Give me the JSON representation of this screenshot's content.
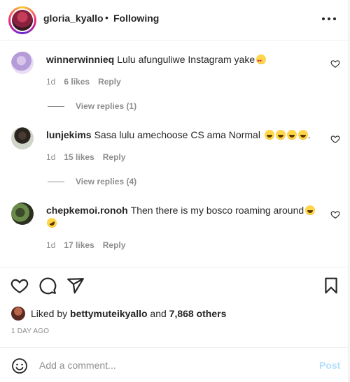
{
  "header": {
    "username": "gloria_kyallo",
    "separator": "•",
    "follow_status": "Following"
  },
  "comments": [
    {
      "username": "winnerwinnieq",
      "text": "Lulu afunguliwe Instagram yake",
      "emojis": [
        "heart-eyes"
      ],
      "time": "1d",
      "likes": "6 likes",
      "reply_label": "Reply",
      "view_replies": "View replies (1)"
    },
    {
      "username": "lunjekims",
      "text": "Sasa lulu amechoose CS ama Normal",
      "emojis": [
        "laughing",
        "laughing",
        "laughing",
        "laughing"
      ],
      "trailing": ".",
      "time": "1d",
      "likes": "15 likes",
      "reply_label": "Reply",
      "view_replies": "View replies (4)"
    },
    {
      "username": "chepkemoi.ronoh",
      "text": "Then there is my bosco roaming around",
      "emojis": [
        "laughing",
        "rofl"
      ],
      "time": "1d",
      "likes": "17 likes",
      "reply_label": "Reply"
    }
  ],
  "likes": {
    "prefix": "Liked by",
    "user": "bettymuteikyallo",
    "joiner": "and",
    "others": "7,868 others"
  },
  "timestamp": "1 DAY AGO",
  "add_comment": {
    "placeholder": "Add a comment...",
    "post_label": "Post"
  },
  "colors": {
    "text": "#262626",
    "muted": "#8e8e8e",
    "post_disabled": "#b2dffc",
    "border": "#efefef"
  },
  "icons": [
    "more-icon",
    "heart-icon",
    "comment-icon",
    "share-icon",
    "bookmark-icon",
    "smile-icon"
  ]
}
